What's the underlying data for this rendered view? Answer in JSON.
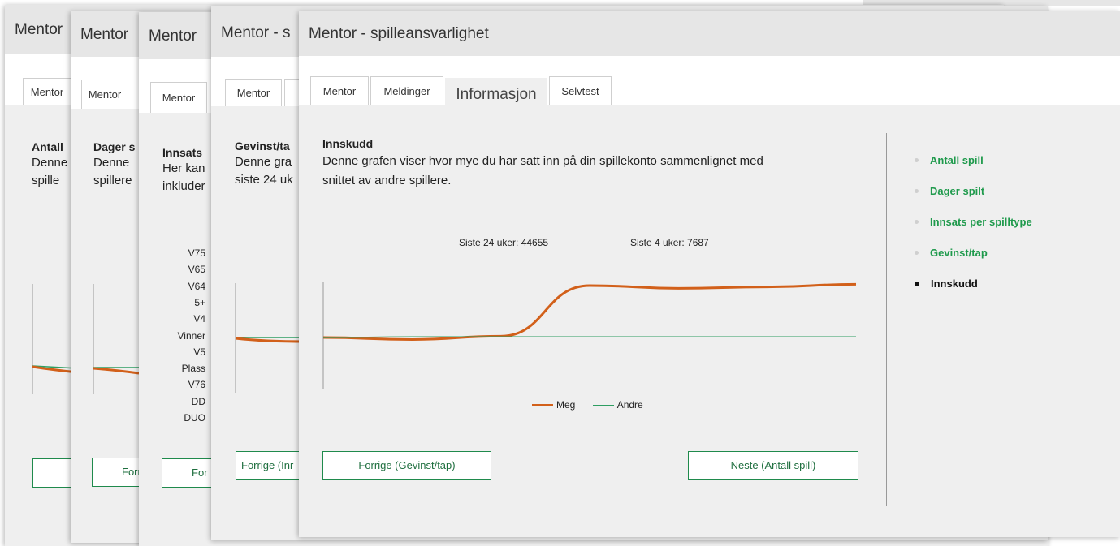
{
  "window_title": "Mentor - spilleansvarlighet",
  "tabs": {
    "mentor": "Mentor",
    "meldinger": "Meldinger",
    "informasjon": "Informasjon",
    "selvtest": "Selvtest"
  },
  "back_windows": {
    "w1": {
      "title": "Mentor",
      "tab": "Mentor",
      "heading": "Antall",
      "line1": "Denne",
      "line2": "spille"
    },
    "w2": {
      "title": "Mentor",
      "tab": "Mentor",
      "heading": "Dager s",
      "line1": "Denne",
      "line2": "spillere",
      "button": "Forr"
    },
    "w3": {
      "title": "Mentor",
      "tab": "Mentor",
      "heading": "Innsats",
      "line1": "Her kan",
      "line2": "inkluder",
      "button": "For",
      "game_types": [
        "V75",
        "V65",
        "V64",
        "5+",
        "V4",
        "Vinner",
        "V5",
        "Plass",
        "V76",
        "DD",
        "DUO"
      ]
    },
    "w4": {
      "title": "Mentor - s",
      "tab": "Mentor",
      "heading": "Gevinst/ta",
      "line1": "Denne gra",
      "line2": "siste 24 uk",
      "button": "Forrige (Inr"
    }
  },
  "main": {
    "heading": "Innskudd",
    "description_line1": "Denne grafen viser hvor mye du har satt inn på din spillekonto sammenlignet med",
    "description_line2": "snittet av andre spillere.",
    "stat_24": "Siste 24 uker: 44655",
    "stat_4": "Siste 4 uker: 7687",
    "prev_button": "Forrige (Gevinst/tap)",
    "next_button": "Neste (Antall spill)"
  },
  "chart_data": {
    "type": "line",
    "title": "",
    "xlabel": "",
    "ylabel": "",
    "legend_position": "bottom",
    "series": [
      {
        "name": "Meg",
        "color": "#d2601a",
        "values": [
          0,
          -0.03,
          0.02,
          0.78,
          0.74,
          0.76,
          0.8
        ]
      },
      {
        "name": "Andre",
        "color": "#2e9e62",
        "values": [
          0,
          0.01,
          0.01,
          0.01,
          0.01,
          0.01,
          0.01
        ]
      }
    ]
  },
  "side_nav": {
    "items": [
      "Antall spill",
      "Dager spilt",
      "Innsats per spilltype",
      "Gevinst/tap",
      "Innskudd"
    ],
    "current": "Innskudd",
    "link_color": "#1f9a4c"
  }
}
